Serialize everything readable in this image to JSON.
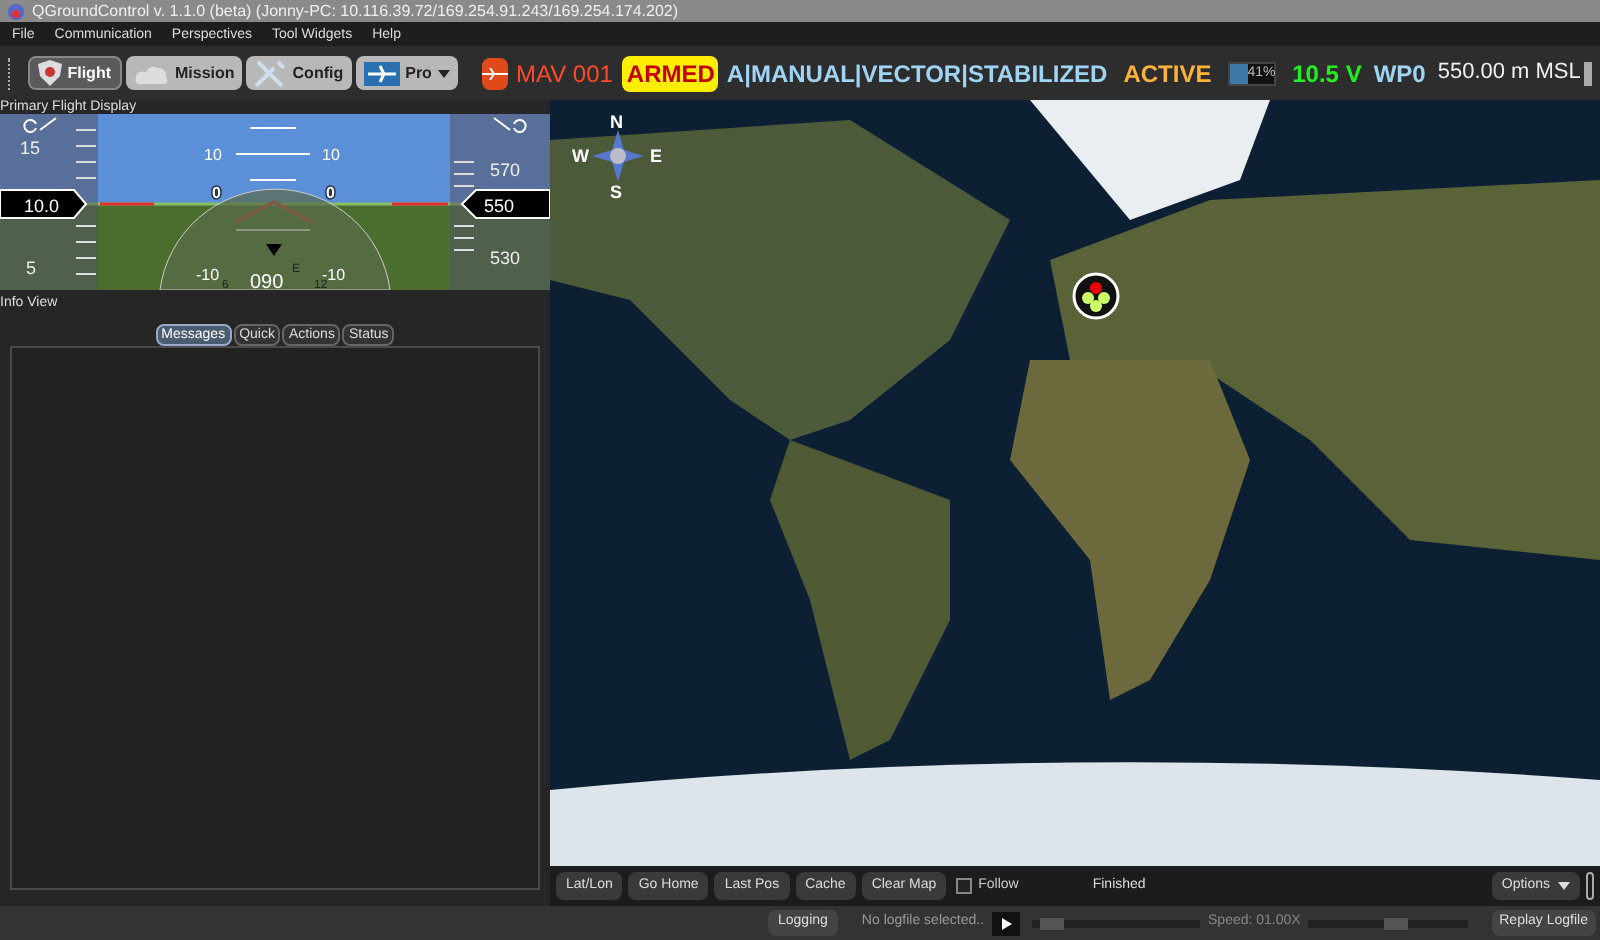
{
  "window": {
    "title": "QGroundControl v. 1.1.0 (beta) (Jonny-PC: 10.116.39.72/169.254.91.243/169.254.174.202)"
  },
  "menu": [
    "File",
    "Communication",
    "Perspectives",
    "Tool Widgets",
    "Help"
  ],
  "perspectives": [
    {
      "label": "Flight",
      "selected": true,
      "kind": "flight"
    },
    {
      "label": "Mission",
      "selected": false,
      "kind": "mission"
    },
    {
      "label": "Config",
      "selected": false,
      "kind": "config"
    },
    {
      "label": "Pro",
      "selected": false,
      "kind": "pro"
    }
  ],
  "vehicle": {
    "name": "MAV 001",
    "armed": "ARMED",
    "mode": "A|MANUAL|VECTOR|STABILIZED",
    "state": "ACTIVE",
    "battery": {
      "level": 0.41,
      "reading": "41%"
    },
    "voltage": "10.5 V",
    "waypoint": "WP0",
    "altitude": "550.00 m MSL"
  },
  "pfd": {
    "title": "Primary Flight Display",
    "speed_ticks": [
      "15",
      "5"
    ],
    "speed": "10.0",
    "altitude_ticks": [
      "570",
      "530"
    ],
    "altitude": "550",
    "pitch_labels": [
      "10",
      "10",
      "0",
      "0",
      "-10",
      "-10"
    ],
    "heading": "090",
    "compass_labels": [
      "E",
      "6",
      "12"
    ]
  },
  "info_view": {
    "title": "Info View",
    "tabs": [
      {
        "label": "Messages",
        "selected": true
      },
      {
        "label": "Quick",
        "selected": false
      },
      {
        "label": "Actions",
        "selected": false
      },
      {
        "label": "Status",
        "selected": false
      }
    ]
  },
  "map": {
    "compass": [
      "N",
      "E",
      "S",
      "W"
    ],
    "buttons": [
      "Lat/Lon",
      "Go Home",
      "Last Pos",
      "Cache",
      "Clear Map"
    ],
    "follow": {
      "label": "Follow",
      "checked": false
    },
    "status": "Finished",
    "options": "Options"
  },
  "status_bar": {
    "logging": "Logging",
    "logfile": "No logfile selected..",
    "speed": "Speed: 01.00X",
    "speed_slider": {
      "level": 0.55
    },
    "progress": {
      "level": 0.05
    },
    "replay": "Replay Logfile"
  }
}
